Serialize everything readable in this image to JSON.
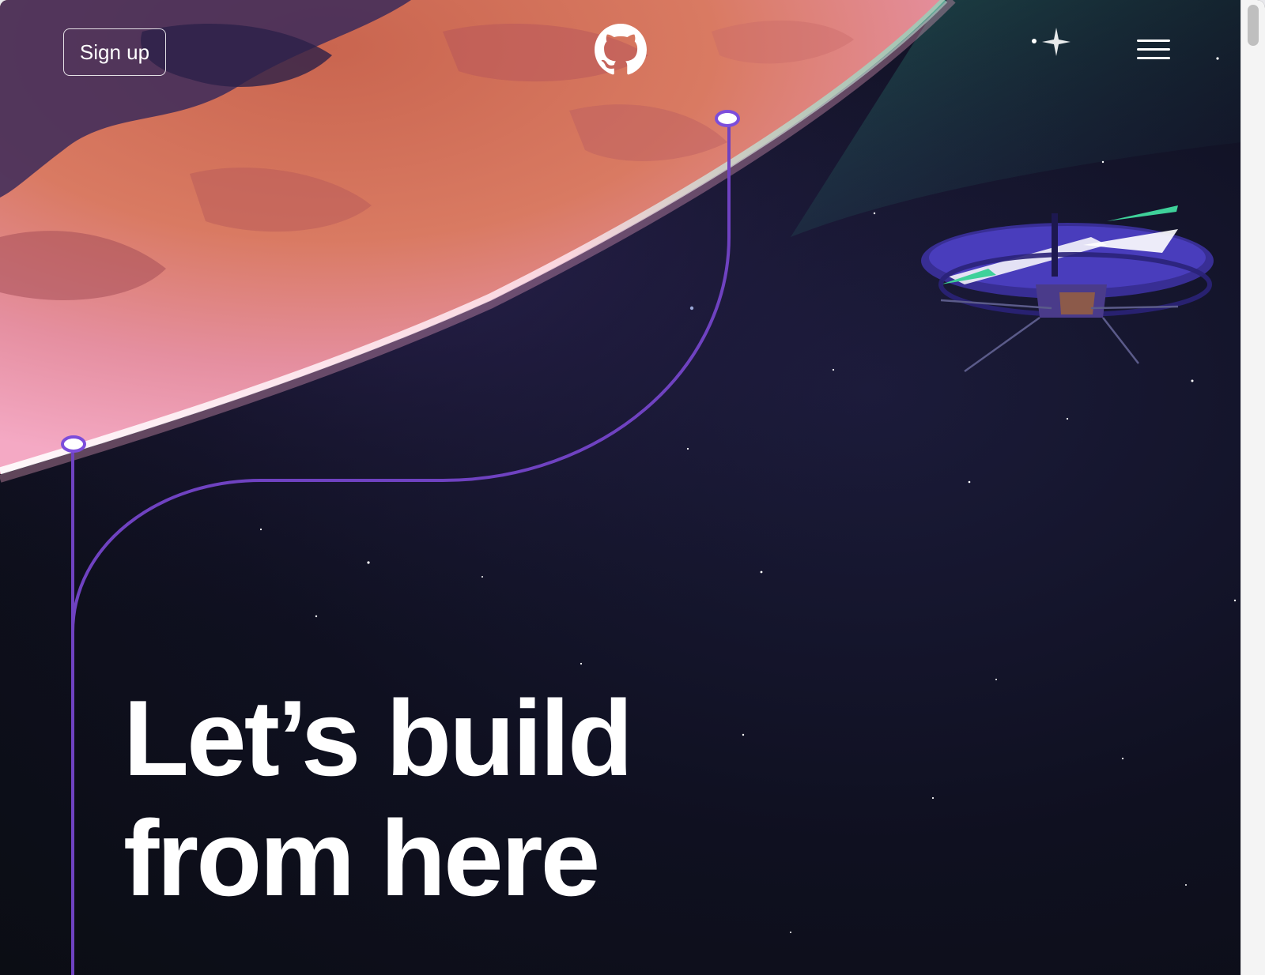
{
  "header": {
    "signup_label": "Sign up",
    "logo_icon": "github-mark-icon",
    "menu_icon": "hamburger-menu-icon"
  },
  "hero": {
    "title_line1": "Let’s build",
    "title_line2": "from here"
  },
  "illustration": {
    "planet": "planet-illustration",
    "drone": "helicopter-drone-illustration"
  },
  "colors": {
    "background": "#0d1117",
    "accent_line": "#7c4ddb",
    "planet_orange": "#e07a5f",
    "planet_pink": "#f2a0c0",
    "text": "#ffffff"
  }
}
